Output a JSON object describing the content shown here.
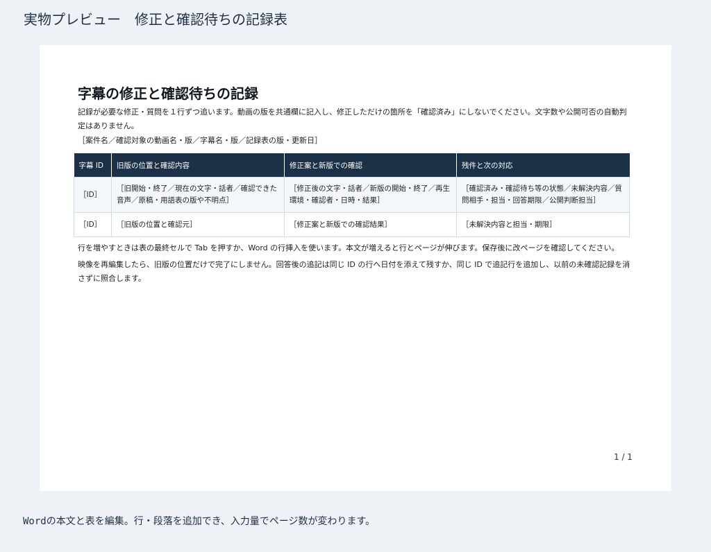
{
  "header": {
    "title": "実物プレビュー　修正と確認待ちの記録表"
  },
  "document": {
    "title": "字幕の修正と確認待ちの記録",
    "intro": "記録が必要な修正・質問を１行ずつ追います。動画の版を共通欄に記入し、修正しただけの箇所を「確認済み」にしないでください。文字数や公開可否の自動判定はありません。",
    "meta": "［案件名／確認対象の動画名・版／字幕名・版／記録表の版・更新日］",
    "table": {
      "headers": [
        "字幕 ID",
        "旧版の位置と確認内容",
        "修正案と新版での確認",
        "残件と次の対応"
      ],
      "rows": [
        [
          "［ID］",
          "［旧開始・終了／現在の文字・話者／確認できた音声／原稿・用語表の版や不明点］",
          "［修正後の文字・話者／新版の開始・終了／再生環境・確認者・日時・結果］",
          "［確認済み・確認待ち等の状態／未解決内容／質問相手・担当・回答期限／公開判断担当］"
        ],
        [
          "［ID］",
          "［旧版の位置と確認元］",
          "［修正案と新版での確認結果］",
          "［未解決内容と担当・期限］"
        ]
      ]
    },
    "note1": "行を増やすときは表の最終セルで Tab を押すか、Word の行挿入を使います。本文が増えると行とページが伸びます。保存後に改ページを確認してください。",
    "note2": "映像を再編集したら、旧版の位置だけで完了にしません。回答後の追記は同じ ID の行へ日付を添えて残すか、同じ ID で追記行を追加し、以前の未確認記録を消さずに照合します。",
    "page_number": "1 / 1"
  },
  "footer": {
    "text": "Wordの本文と表を編集。行・段落を追加でき、入力量でページ数が変わります。"
  },
  "colors": {
    "background": "#eef2f6",
    "page": "#ffffff",
    "table_header": "#1c3148",
    "heading_text": "#1f3044"
  }
}
